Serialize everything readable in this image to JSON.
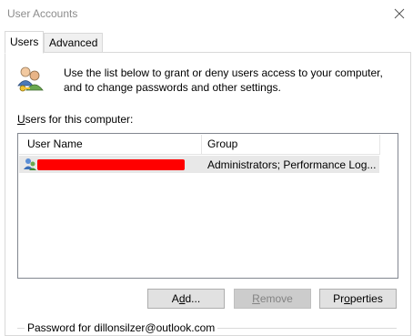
{
  "window": {
    "title": "User Accounts"
  },
  "tabs": [
    {
      "label": "Users",
      "active": true
    },
    {
      "label": "Advanced",
      "active": false
    }
  ],
  "intro_text": "Use the list below to grant or deny users access to your computer, and to change passwords and other settings.",
  "users_list": {
    "label_prefix": "U",
    "label_rest": "sers for this computer:",
    "columns": [
      "User Name",
      "Group"
    ],
    "rows": [
      {
        "user_name": "",
        "group": "Administrators; Performance Log..."
      }
    ]
  },
  "buttons": {
    "add_prefix": "A",
    "add_underlined": "d",
    "add_suffix": "d...",
    "remove_prefix": "",
    "remove_underlined": "R",
    "remove_suffix": "emove",
    "properties_prefix": "Pr",
    "properties_underlined": "o",
    "properties_suffix": "perties"
  },
  "password_section": {
    "label": "Password for dillonsilzer@outlook.com"
  },
  "colors": {
    "redaction": "#ff0000",
    "selected_row": "#e8e8e8"
  }
}
